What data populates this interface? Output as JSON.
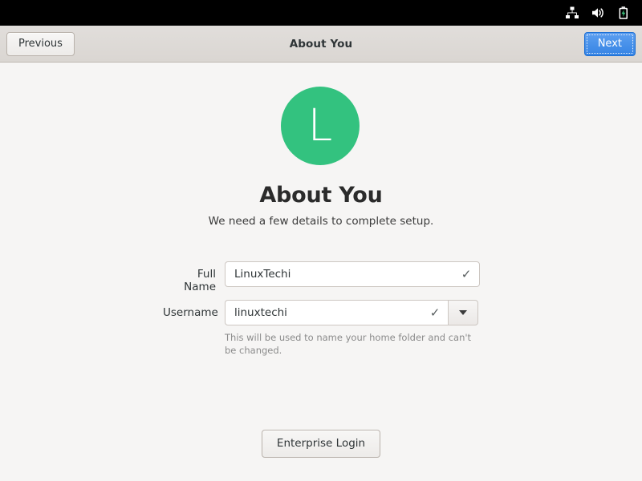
{
  "topbar": {
    "icons": [
      {
        "name": "network-wired-icon",
        "label": "network-wired"
      },
      {
        "name": "volume-icon",
        "label": "volume"
      },
      {
        "name": "battery-charging-icon",
        "label": "battery-charging"
      }
    ],
    "background": "#000000"
  },
  "header": {
    "title": "About You",
    "previous_label": "Previous",
    "next_label": "Next",
    "next_color": "#3584e4"
  },
  "main": {
    "avatar_letter": "L",
    "avatar_color": "#33c27f",
    "heading": "About You",
    "subtitle": "We need a few details to complete setup.",
    "enterprise_login_label": "Enterprise Login"
  },
  "form": {
    "fields": [
      {
        "label": "Full Name",
        "value": "LinuxTechi",
        "placeholder": "",
        "valid_icon": "✓",
        "has_dropdown": false
      },
      {
        "label": "Username",
        "value": "linuxtechi",
        "placeholder": "",
        "valid_icon": "✓",
        "has_dropdown": true
      }
    ],
    "helper_text": "This will be used to name your home folder and can't be changed."
  }
}
